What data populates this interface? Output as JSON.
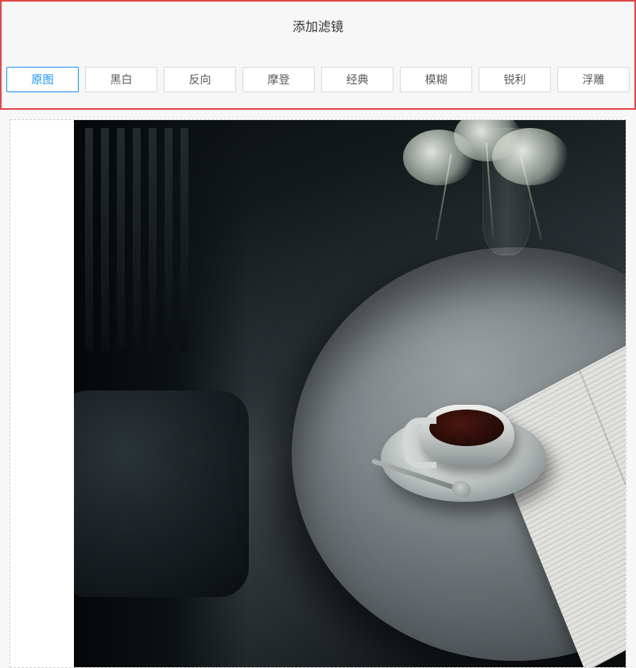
{
  "header": {
    "title": "添加滤镜"
  },
  "filters": [
    {
      "label": "原图",
      "active": true
    },
    {
      "label": "黑白",
      "active": false
    },
    {
      "label": "反向",
      "active": false
    },
    {
      "label": "摩登",
      "active": false
    },
    {
      "label": "经典",
      "active": false
    },
    {
      "label": "模糊",
      "active": false
    },
    {
      "label": "锐利",
      "active": false
    },
    {
      "label": "浮雕",
      "active": false
    }
  ]
}
